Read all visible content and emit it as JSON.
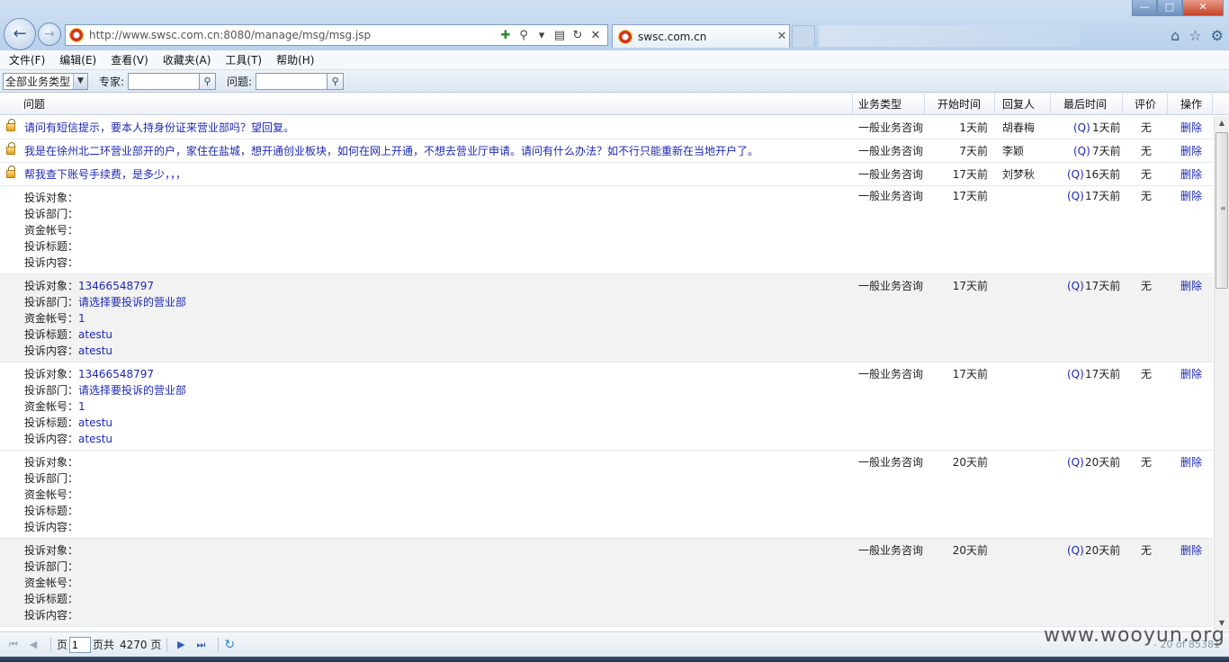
{
  "browser": {
    "url": "http://www.swsc.com.cn:8080/manage/msg/msg.jsp",
    "tab_title": "swsc.com.cn",
    "icons": [
      "back-arrow-icon",
      "forward-arrow-icon",
      "compat-view-icon",
      "search-icon",
      "refresh-icon",
      "stop-icon",
      "home-icon",
      "favorites-star-icon",
      "gear-icon"
    ],
    "window_buttons": {
      "minimize": "—",
      "maximize": "□",
      "close": "✕"
    }
  },
  "menu": [
    "文件(F)",
    "编辑(E)",
    "查看(V)",
    "收藏夹(A)",
    "工具(T)",
    "帮助(H)"
  ],
  "toolbar": {
    "type_select_value": "全部业务类型",
    "expert_label": "专家:",
    "question_label": "问题:"
  },
  "columns": {
    "question": "问题",
    "type": "业务类型",
    "start": "开始时间",
    "replier": "回复人",
    "last": "最后时间",
    "rating": "评价",
    "action": "操作"
  },
  "rows": [
    {
      "question": "请问有短信提示，要本人持身份证来营业部吗？望回复。",
      "type": "一般业务咨询",
      "start": "1天前",
      "replier": "胡春梅",
      "q": "(Q)",
      "last": "1天前",
      "rating": "无",
      "action": "删除"
    },
    {
      "question": "我是在徐州北二环营业部开的户，家住在盐城，想开通创业板块，如何在网上开通，不想去营业厅申请。请问有什么办法？如不行只能重新在当地开户了。",
      "type": "一般业务咨询",
      "start": "7天前",
      "replier": "李颖",
      "q": "(Q)",
      "last": "7天前",
      "rating": "无",
      "action": "删除"
    },
    {
      "question": "帮我查下账号手续费，是多少，，，",
      "type": "一般业务咨询",
      "start": "17天前",
      "replier": "刘梦秋",
      "q": "(Q)",
      "last": "16天前",
      "rating": "无",
      "action": "删除"
    },
    {
      "lines": [
        {
          "k": "投诉对象：",
          "v": ""
        },
        {
          "k": "投诉部门：",
          "v": ""
        },
        {
          "k": "资金帐号：",
          "v": ""
        },
        {
          "k": "投诉标题：",
          "v": ""
        },
        {
          "k": "投诉内容：",
          "v": ""
        }
      ],
      "type": "一般业务咨询",
      "start": "17天前",
      "replier": "",
      "q": "(Q)",
      "last": "17天前",
      "rating": "无",
      "action": "删除"
    },
    {
      "lines": [
        {
          "k": "投诉对象：",
          "v": "13466548797"
        },
        {
          "k": "投诉部门：",
          "v": "请选择要投诉的营业部"
        },
        {
          "k": "资金帐号：",
          "v": "1"
        },
        {
          "k": "投诉标题：",
          "v": "atestu"
        },
        {
          "k": "投诉内容：",
          "v": "atestu"
        }
      ],
      "type": "一般业务咨询",
      "start": "17天前",
      "replier": "",
      "q": "(Q)",
      "last": "17天前",
      "rating": "无",
      "action": "删除"
    },
    {
      "lines": [
        {
          "k": "投诉对象：",
          "v": "13466548797"
        },
        {
          "k": "投诉部门：",
          "v": "请选择要投诉的营业部"
        },
        {
          "k": "资金帐号：",
          "v": "1"
        },
        {
          "k": "投诉标题：",
          "v": "atestu"
        },
        {
          "k": "投诉内容：",
          "v": "atestu"
        }
      ],
      "type": "一般业务咨询",
      "start": "17天前",
      "replier": "",
      "q": "(Q)",
      "last": "17天前",
      "rating": "无",
      "action": "删除"
    },
    {
      "lines": [
        {
          "k": "投诉对象：",
          "v": ""
        },
        {
          "k": "投诉部门：",
          "v": ""
        },
        {
          "k": "资金帐号：",
          "v": ""
        },
        {
          "k": "投诉标题：",
          "v": ""
        },
        {
          "k": "投诉内容：",
          "v": ""
        }
      ],
      "type": "一般业务咨询",
      "start": "20天前",
      "replier": "",
      "q": "(Q)",
      "last": "20天前",
      "rating": "无",
      "action": "删除"
    },
    {
      "lines": [
        {
          "k": "投诉对象：",
          "v": ""
        },
        {
          "k": "投诉部门：",
          "v": ""
        },
        {
          "k": "资金帐号：",
          "v": ""
        },
        {
          "k": "投诉标题：",
          "v": ""
        },
        {
          "k": "投诉内容：",
          "v": ""
        }
      ],
      "type": "一般业务咨询",
      "start": "20天前",
      "replier": "",
      "q": "(Q)",
      "last": "20天前",
      "rating": "无",
      "action": "删除"
    }
  ],
  "pager": {
    "page_label": "页",
    "page_value": "1",
    "total_label": "页共",
    "total_pages": "4270 页",
    "status_right": "- 20 of 85381"
  },
  "watermark": "www.wooyun.org"
}
